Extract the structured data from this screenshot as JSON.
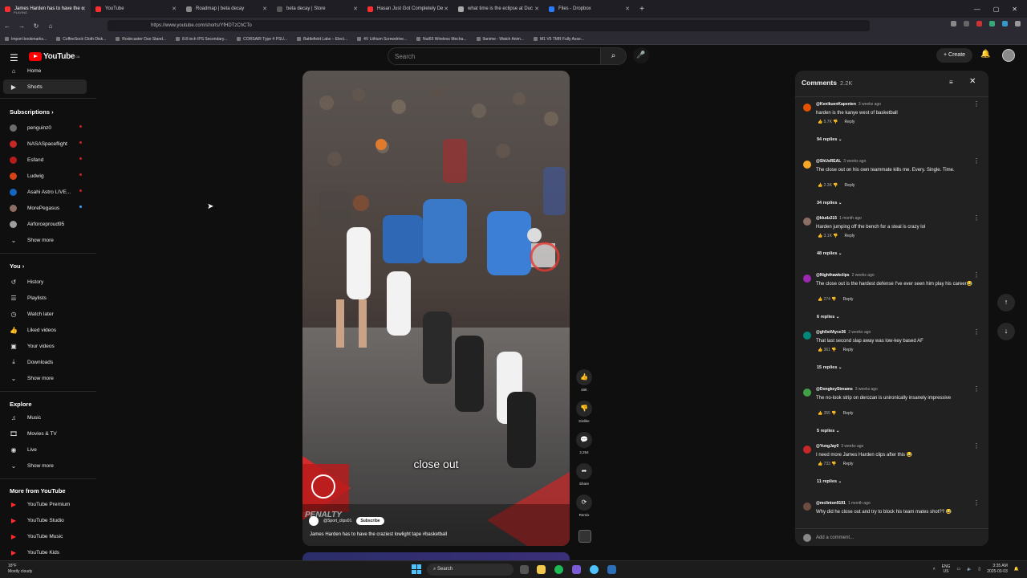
{
  "browser": {
    "tabs": [
      {
        "title": "James Harden has to have the c",
        "subtitle": "PLAYING",
        "color": "#ff2d2d",
        "active": true
      },
      {
        "title": "YouTube",
        "color": "#ff2d2d"
      },
      {
        "title": "Roadmap | beta decay",
        "color": "#888888"
      },
      {
        "title": "beta decay | Store",
        "color": "#555555"
      },
      {
        "title": "Hasan Just Got Completely De",
        "color": "#ff2d2d"
      },
      {
        "title": "what time is the eclipse at Duc",
        "color": "#aaaaaa"
      },
      {
        "title": "Files - Dropbox",
        "color": "#2b7bff"
      }
    ],
    "url": "https://www.youtube.com/shorts/YfHDTzChCTo",
    "bookmarks": [
      "Import bookmarks...",
      "CoffeeSock Cloth Disk...",
      "Rodecaster Duo Stand...",
      "8.8 inch IPS Secondary...",
      "CORSAIR Type 4 PSU...",
      "Battlefield Labs – Elect...",
      "4V Lithium Screwdrive...",
      "Nut65 Wireless Mecha...",
      "9anime - Watch Anim...",
      "M1 V5 TMR Fully Asse..."
    ]
  },
  "header": {
    "logo_text": "YouTube",
    "logo_region": "CA",
    "search_placeholder": "Search",
    "create_label": "Create"
  },
  "sidebar": {
    "top": [
      {
        "label": "Home",
        "icon": "home-icon",
        "glyph": "⌂"
      },
      {
        "label": "Shorts",
        "icon": "shorts-icon",
        "glyph": "▶",
        "selected": true
      }
    ],
    "subscriptions_title": "Subscriptions",
    "subscriptions": [
      {
        "label": "penguinz0",
        "color": "#6c6c6c",
        "live": true
      },
      {
        "label": "NASASpaceflight",
        "color": "#c62828",
        "live": true
      },
      {
        "label": "Esfand",
        "color": "#b71c1c",
        "live": true
      },
      {
        "label": "Ludwig",
        "color": "#d84315",
        "live": true
      },
      {
        "label": "Asahi Astro LIVE...",
        "color": "#1565c0",
        "live": true
      },
      {
        "label": "MorePegasus",
        "color": "#8d6e63",
        "new": true
      },
      {
        "label": "Airforceproud95",
        "color": "#9e9e9e"
      }
    ],
    "show_more": "Show more",
    "you_title": "You",
    "you_items": [
      {
        "label": "History",
        "glyph": "↺",
        "icon": "history-icon"
      },
      {
        "label": "Playlists",
        "glyph": "☰",
        "icon": "playlists-icon"
      },
      {
        "label": "Watch later",
        "glyph": "◷",
        "icon": "watch-later-icon"
      },
      {
        "label": "Liked videos",
        "glyph": "👍",
        "icon": "like-icon"
      },
      {
        "label": "Your videos",
        "glyph": "▣",
        "icon": "your-videos-icon"
      },
      {
        "label": "Downloads",
        "glyph": "⤓",
        "icon": "download-icon"
      }
    ],
    "explore_title": "Explore",
    "explore_items": [
      {
        "label": "Music",
        "glyph": "♫",
        "icon": "music-icon"
      },
      {
        "label": "Movies & TV",
        "glyph": "🎞",
        "icon": "movies-icon"
      },
      {
        "label": "Live",
        "glyph": "◉",
        "icon": "live-icon"
      }
    ],
    "more_title": "More from YouTube",
    "more_items": [
      {
        "label": "YouTube Premium"
      },
      {
        "label": "YouTube Studio"
      },
      {
        "label": "YouTube Music"
      },
      {
        "label": "YouTube Kids"
      }
    ]
  },
  "short": {
    "caption": "close out",
    "channel": "@Sport_clips01",
    "subscribe_label": "Subscribe",
    "title": "James Harden has to have the craziest lowlight tape #basketball",
    "banner_text": "PENALTY",
    "likes": "48K",
    "dislike_label": "Dislike",
    "comments_count": "2,264",
    "share_label": "Share",
    "remix_label": "Remix"
  },
  "comments_panel": {
    "title": "Comments",
    "count": "2.2K",
    "add_placeholder": "Add a comment...",
    "reply_label": "Reply",
    "items": [
      {
        "author": "@KenikuenKapenien",
        "time": "3 weeks ago",
        "text": "harden is the kanye west of basketball",
        "likes": "5.7K",
        "replies": "94 replies",
        "color": "#e65100"
      },
      {
        "author": "@ShUsREAL",
        "time": "3 weeks ago",
        "text": "The close out on his own teammate kills me. Every. Single. Time.",
        "likes": "2.3K",
        "replies": "34 replies",
        "color": "#f9a825"
      },
      {
        "author": "@kludz215",
        "time": "1 month ago",
        "text": "Harden jumping off the bench for a steal is crazy lol",
        "likes": "3.1K",
        "replies": "48 replies",
        "color": "#8d6e63"
      },
      {
        "author": "@Nighthawkclips",
        "time": "2 weeks ago",
        "text": "The close out is the hardest defense I've ever seen him play his career😂",
        "likes": "274",
        "replies": "6 replies",
        "color": "#9c27b0"
      },
      {
        "author": "@gh0stfAyce36",
        "time": "2 weeks ago",
        "text": "That last second slap away was low-key based AF",
        "likes": "361",
        "replies": "15 replies",
        "color": "#00897b"
      },
      {
        "author": "@DongkeyStreams",
        "time": "3 weeks ago",
        "text": "The no-look strip on derozan is unironically insanely impressive",
        "likes": "355",
        "replies": "5 replies",
        "color": "#43a047"
      },
      {
        "author": "@YungJay0",
        "time": "3 weeks ago",
        "text": "I need more James Harden clips after this 😂",
        "likes": "733",
        "replies": "11 replies",
        "color": "#c62828"
      },
      {
        "author": "@mclinton9191",
        "time": "1 month ago",
        "text": "Why did he close out and try to block his team mates shot?? 😂",
        "likes": "",
        "replies": "",
        "color": "#6d4c41"
      }
    ]
  },
  "taskbar": {
    "weather_temp": "18°F",
    "weather_desc": "Mostly cloudy",
    "search_label": "Search",
    "lang": "ENG",
    "region": "US",
    "time": "3:35 AM",
    "date": "2025-03-03"
  }
}
